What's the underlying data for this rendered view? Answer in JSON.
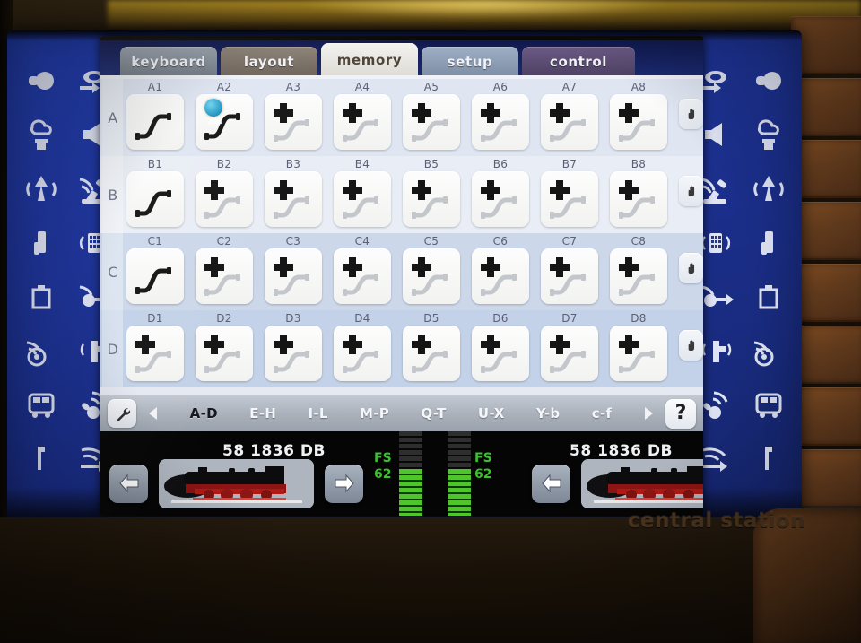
{
  "device": {
    "branding": "central station"
  },
  "tabs": [
    {
      "label": "keyboard",
      "active": false
    },
    {
      "label": "layout",
      "active": false
    },
    {
      "label": "memory",
      "active": true
    },
    {
      "label": "setup",
      "active": false
    },
    {
      "label": "control",
      "active": false
    }
  ],
  "memory": {
    "rows": [
      {
        "letter": "A",
        "hand_icon": "hand-icon",
        "cells": [
          {
            "label": "A1",
            "icon": "turnout-curved-dark",
            "plus": false,
            "cursor": false
          },
          {
            "label": "A2",
            "icon": "turnout-curved-dark",
            "plus": false,
            "cursor": true
          },
          {
            "label": "A3",
            "icon": "turnout-curved-light",
            "plus": true,
            "cursor": false
          },
          {
            "label": "A4",
            "icon": "turnout-curved-light",
            "plus": true,
            "cursor": false
          },
          {
            "label": "A5",
            "icon": "turnout-curved-light",
            "plus": true,
            "cursor": false
          },
          {
            "label": "A6",
            "icon": "turnout-curved-light",
            "plus": true,
            "cursor": false
          },
          {
            "label": "A7",
            "icon": "turnout-curved-light",
            "plus": true,
            "cursor": false
          },
          {
            "label": "A8",
            "icon": "turnout-curved-light",
            "plus": true,
            "cursor": false
          }
        ]
      },
      {
        "letter": "B",
        "hand_icon": "hand-icon",
        "cells": [
          {
            "label": "B1",
            "icon": "turnout-curved-dark",
            "plus": false,
            "cursor": false
          },
          {
            "label": "B2",
            "icon": "turnout-curved-light",
            "plus": true,
            "cursor": false
          },
          {
            "label": "B3",
            "icon": "turnout-curved-light",
            "plus": true,
            "cursor": false
          },
          {
            "label": "B4",
            "icon": "turnout-curved-light",
            "plus": true,
            "cursor": false
          },
          {
            "label": "B5",
            "icon": "turnout-curved-light",
            "plus": true,
            "cursor": false
          },
          {
            "label": "B6",
            "icon": "turnout-curved-light",
            "plus": true,
            "cursor": false
          },
          {
            "label": "B7",
            "icon": "turnout-curved-light",
            "plus": true,
            "cursor": false
          },
          {
            "label": "B8",
            "icon": "turnout-curved-light",
            "plus": true,
            "cursor": false
          }
        ]
      },
      {
        "letter": "C",
        "hand_icon": "hand-icon",
        "cells": [
          {
            "label": "C1",
            "icon": "turnout-curved-dark",
            "plus": false,
            "cursor": false
          },
          {
            "label": "C2",
            "icon": "turnout-curved-light",
            "plus": true,
            "cursor": false
          },
          {
            "label": "C3",
            "icon": "turnout-curved-light",
            "plus": true,
            "cursor": false
          },
          {
            "label": "C4",
            "icon": "turnout-curved-light",
            "plus": true,
            "cursor": false
          },
          {
            "label": "C5",
            "icon": "turnout-curved-light",
            "plus": true,
            "cursor": false
          },
          {
            "label": "C6",
            "icon": "turnout-curved-light",
            "plus": true,
            "cursor": false
          },
          {
            "label": "C7",
            "icon": "turnout-curved-light",
            "plus": true,
            "cursor": false
          },
          {
            "label": "C8",
            "icon": "turnout-curved-light",
            "plus": true,
            "cursor": false
          }
        ]
      },
      {
        "letter": "D",
        "hand_icon": "hand-icon",
        "cells": [
          {
            "label": "D1",
            "icon": "turnout-curved-light",
            "plus": true,
            "cursor": false
          },
          {
            "label": "D2",
            "icon": "turnout-curved-light",
            "plus": true,
            "cursor": false
          },
          {
            "label": "D3",
            "icon": "turnout-curved-light",
            "plus": true,
            "cursor": false
          },
          {
            "label": "D4",
            "icon": "turnout-curved-light",
            "plus": true,
            "cursor": false
          },
          {
            "label": "D5",
            "icon": "turnout-curved-light",
            "plus": true,
            "cursor": false
          },
          {
            "label": "D6",
            "icon": "turnout-curved-light",
            "plus": true,
            "cursor": false
          },
          {
            "label": "D7",
            "icon": "turnout-curved-light",
            "plus": true,
            "cursor": false
          },
          {
            "label": "D8",
            "icon": "turnout-curved-light",
            "plus": true,
            "cursor": false
          }
        ]
      }
    ]
  },
  "pagebar": {
    "settings_icon": "wrench-icon",
    "prev_icon": "triangle-left-icon",
    "next_icon": "triangle-right-icon",
    "help_label": "?",
    "pages": [
      {
        "label": "A-D",
        "active": true
      },
      {
        "label": "E-H",
        "active": false
      },
      {
        "label": "I-L",
        "active": false
      },
      {
        "label": "M-P",
        "active": false
      },
      {
        "label": "Q-T",
        "active": false
      },
      {
        "label": "U-X",
        "active": false
      },
      {
        "label": "Y-b",
        "active": false
      },
      {
        "label": "c-f",
        "active": false
      }
    ]
  },
  "loco_left": {
    "name": "58 1836 DB",
    "prev_icon": "arrow-left-icon",
    "next_icon": "arrow-right-icon",
    "image_name": "steam-locomotive-image",
    "speed_unit": "FS",
    "speed_value": "62",
    "speed_percent": 55
  },
  "loco_right": {
    "name": "58 1836 DB",
    "prev_icon": "arrow-left-icon",
    "next_icon": "arrow-right-icon",
    "image_name": "steam-locomotive-image",
    "speed_unit": "FS",
    "speed_value": "62",
    "speed_percent": 55
  },
  "bezel_icons_left": [
    "light-on-icon",
    "direction-change-icon",
    "smoke-generator-icon",
    "horn-icon",
    "steam-whistle-icon",
    "crane-sound-icon",
    "telex-coupler-icon",
    "keypad-sound-icon",
    "bell-weight-icon",
    "fan-shift-icon",
    "siren-icon",
    "pump-sound-icon",
    "railcar-icon",
    "switch-sound-icon",
    "rod-icon",
    "arrow-sound-icon"
  ],
  "bezel_icons_right": [
    "direction-change-icon",
    "light-on-icon",
    "horn-icon",
    "smoke-generator-icon",
    "crane-sound-icon",
    "steam-whistle-icon",
    "keypad-sound-icon",
    "telex-coupler-icon",
    "fan-shift-icon",
    "bell-weight-icon",
    "pump-sound-icon",
    "siren-icon",
    "switch-sound-icon",
    "railcar-icon",
    "arrow-sound-icon",
    "rod-icon"
  ],
  "colors": {
    "bezel_blue": "#20379f",
    "accent_green": "#3ac22a",
    "cursor_blue": "#1d93bf",
    "active_tab": "#f3f2ef"
  }
}
